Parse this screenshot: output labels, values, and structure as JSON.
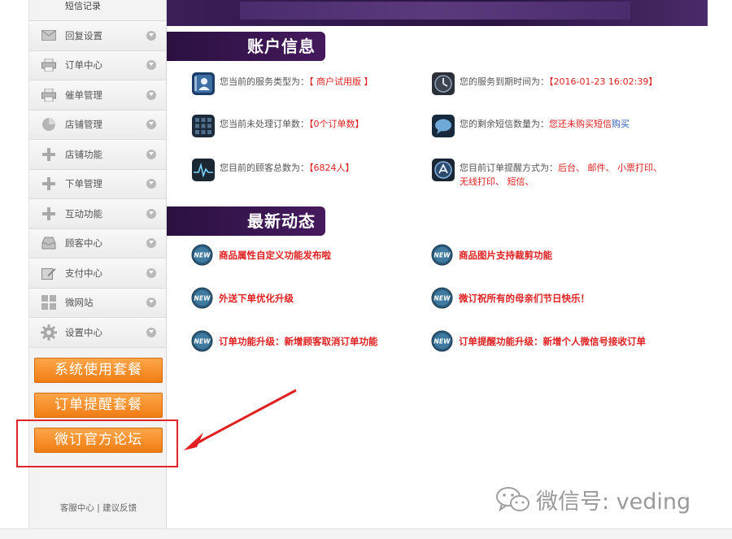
{
  "sidebar": {
    "top_label": "短信记录",
    "items": [
      {
        "label": "回复设置",
        "icon": "mail-icon"
      },
      {
        "label": "订单中心",
        "icon": "printer-icon"
      },
      {
        "label": "催单管理",
        "icon": "printer-icon"
      },
      {
        "label": "店铺管理",
        "icon": "pie-chart-icon"
      },
      {
        "label": "店铺功能",
        "icon": "plus-icon"
      },
      {
        "label": "下单管理",
        "icon": "plus-icon"
      },
      {
        "label": "互动功能",
        "icon": "plus-icon"
      },
      {
        "label": "顾客中心",
        "icon": "inbox-icon"
      },
      {
        "label": "支付中心",
        "icon": "edit-icon"
      },
      {
        "label": "微网站",
        "icon": "grid-icon"
      },
      {
        "label": "设置中心",
        "icon": "gear-icon"
      }
    ],
    "buttons": [
      "系统使用套餐",
      "订单提醒套餐",
      "微订官方论坛"
    ],
    "footer": {
      "service": "客服中心",
      "separator": "|",
      "feedback": "建议反馈"
    }
  },
  "account": {
    "title": "账户信息",
    "service_type_label": "您当前的服务类型为：",
    "service_type_value": "【 商户试用版 】",
    "expire_label": "您的服务到期时间为：",
    "expire_value": "【2016-01-23 16:02:39】",
    "pending_label": "您当前未处理订单数：",
    "pending_value": "【0个订单数】",
    "sms_label": "您的剩余短信数量为：",
    "sms_value": "您还未购买短信",
    "sms_buy": "购买",
    "customers_label": "您目前的顾客总数为：",
    "customers_value": "【6824人】",
    "reminder_label": "您目前订单提醒方式为：",
    "reminder_value_line1": "后台、 邮件、 小票打印、",
    "reminder_value_line2": "无线打印、 短信、"
  },
  "news": {
    "title": "最新动态",
    "items": [
      "商品属性自定义功能发布啦",
      "商品图片支持裁剪功能",
      "外送下单优化升级",
      "微订祝所有的母亲们节日快乐！",
      "订单功能升级：新增顾客取消订单功能",
      "订单提醒功能升级：新增个人微信号接收订单"
    ]
  },
  "watermark": "微信号: veding",
  "colors": {
    "accent_orange": "#f08a24",
    "header_purple": "#3b1652",
    "red_text": "#e02020",
    "highlight_red": "#e0262a"
  }
}
